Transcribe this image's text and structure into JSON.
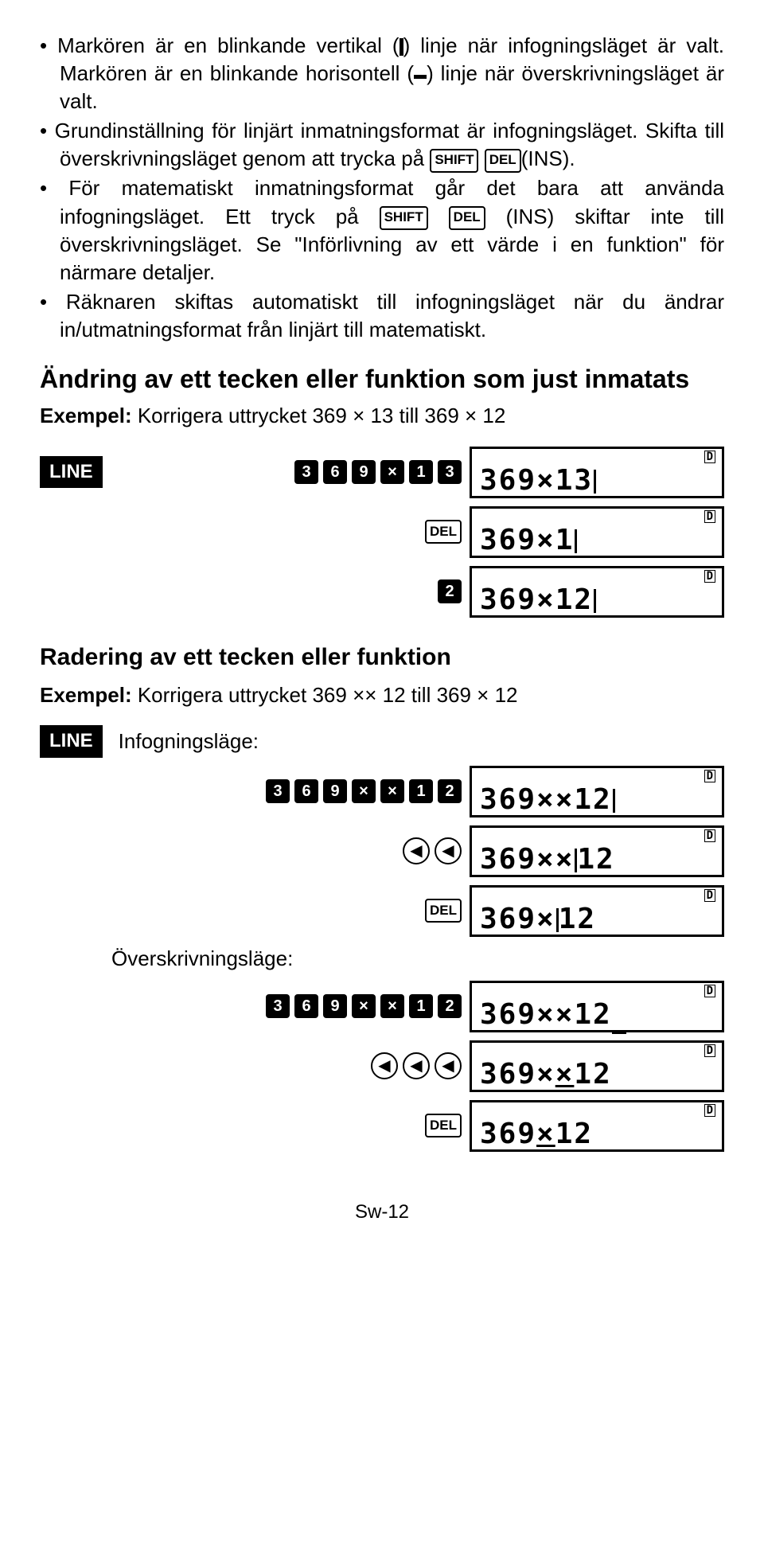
{
  "bullets": {
    "b1a": "Markören är en blinkande vertikal (",
    "b1b": ") linje när infogningsläget är valt. Markören är en blinkande horisontell (",
    "b1c": ") linje när överskrivningsläget är valt.",
    "b2a": "Grundinställning för linjärt inmatningsformat är infogningsläget. Skifta till överskrivningsläget genom att trycka på ",
    "b2b": "(INS).",
    "b3a": "För matematiskt inmatningsformat går det bara att använda infogningsläget. Ett tryck på ",
    "b3b": " (INS) skiftar inte till överskrivningsläget. Se \"Införlivning av ett värde i en funktion\" för närmare detaljer.",
    "b4": "Räknaren skiftas automatiskt till infogningsläget när du ändrar in/utmatningsformat från linjärt till matematiskt."
  },
  "keys": {
    "shift": "SHIFT",
    "del": "DEL"
  },
  "h1": "Ändring av ett tecken eller funktion som just inmatats",
  "ex1label": "Exempel:",
  "ex1text": " Korrigera uttrycket 369 × 13 till 369 × 12",
  "line": "LINE",
  "screens": {
    "s1": "369×13",
    "s2": "369×1",
    "s3": "369×12",
    "s4": "369××12",
    "s5a": "369××",
    "s5b": "12",
    "s6a": "369×",
    "s6b": "12",
    "s7": "369××12",
    "s8a": "369×",
    "s8u": "×",
    "s8b": "12",
    "s9a": "369",
    "s9u": "×",
    "s9b": "12"
  },
  "h2": "Radering av ett tecken eller funktion",
  "ex2label": "Exempel:",
  "ex2text": " Korrigera uttrycket 369 ×× 12 till 369 × 12",
  "sub1": "Infogningsläge:",
  "sub2": "Överskrivningsläge:",
  "page": "Sw-12"
}
